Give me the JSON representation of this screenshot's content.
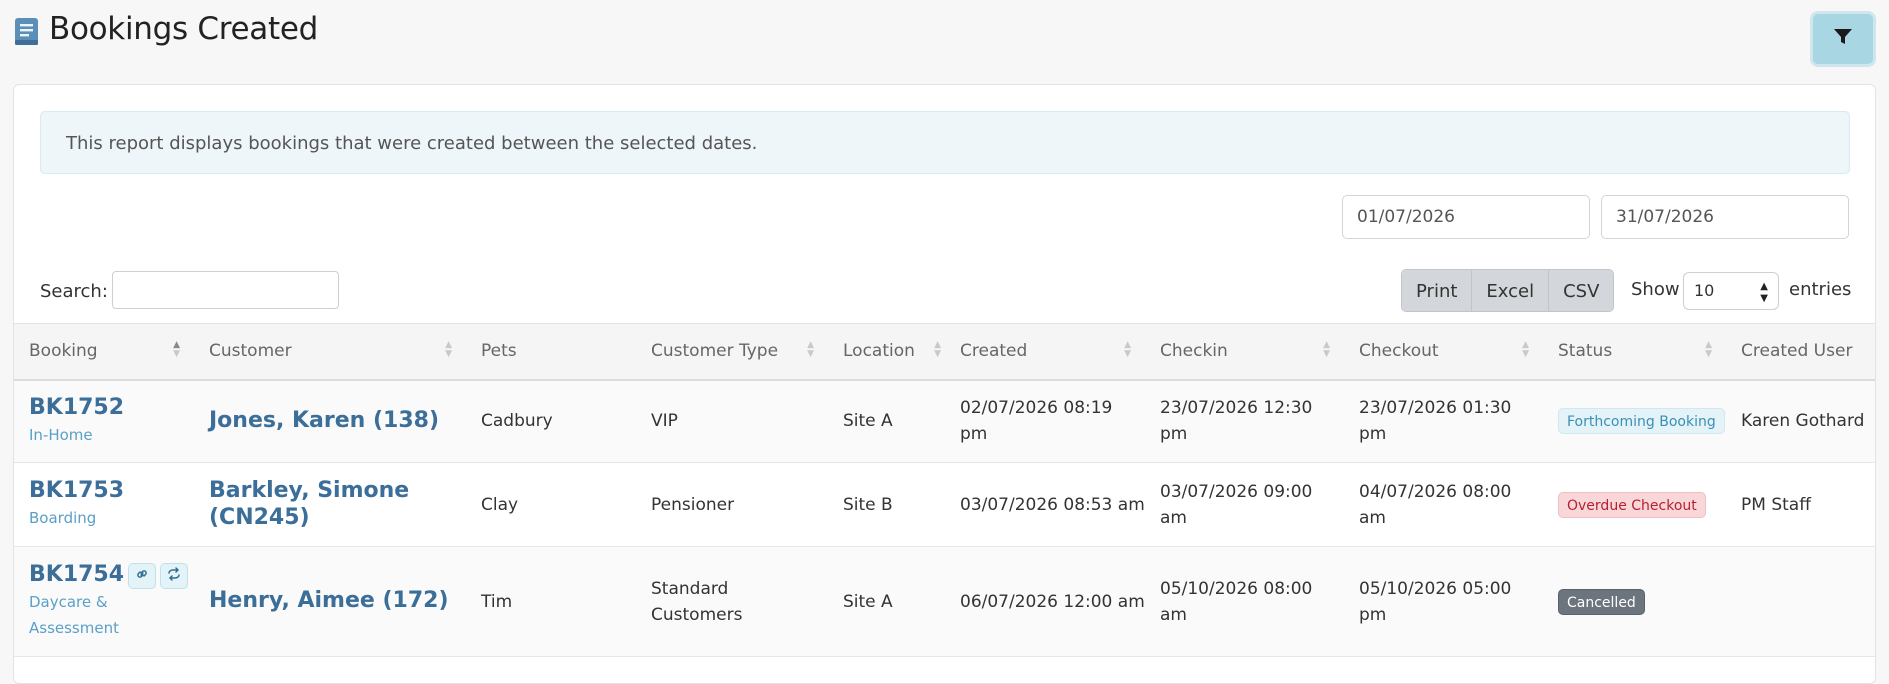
{
  "header": {
    "title": "Bookings Created",
    "title_icon": "report-book-icon",
    "filter_icon": "filter-icon"
  },
  "info": {
    "text": "This report displays bookings that were created between the selected dates."
  },
  "dates": {
    "from": "01/07/2026",
    "to": "31/07/2026"
  },
  "search": {
    "label": "Search:",
    "value": ""
  },
  "export": {
    "print": "Print",
    "excel": "Excel",
    "csv": "CSV"
  },
  "length": {
    "show_label": "Show",
    "value": "10",
    "entries_label": "entries"
  },
  "table": {
    "columns": [
      "Booking",
      "Customer",
      "Pets",
      "Customer Type",
      "Location",
      "Created",
      "Checkin",
      "Checkout",
      "Status",
      "Created User"
    ],
    "rows": [
      {
        "booking": "BK1752",
        "booking_type": "In-Home",
        "customer": "Jones, Karen (138)",
        "pets": "Cadbury",
        "customer_type": "VIP",
        "location": "Site A",
        "created": "02/07/2026 08:19 pm",
        "checkin": "23/07/2026 12:30 pm",
        "checkout": "23/07/2026 01:30 pm",
        "status": "Forthcoming Booking",
        "created_user": "Karen Gothard"
      },
      {
        "booking": "BK1753",
        "booking_type": "Boarding",
        "customer": "Barkley, Simone (CN245)",
        "pets": "Clay",
        "customer_type": "Pensioner",
        "location": "Site B",
        "created": "03/07/2026 08:53 am",
        "checkin": "03/07/2026 09:00 am",
        "checkout": "04/07/2026 08:00 am",
        "status": "Overdue Checkout",
        "created_user": "PM Staff"
      },
      {
        "booking": "BK1754",
        "booking_type": "Daycare & Assessment",
        "customer": "Henry, Aimee (172)",
        "pets": "Tim",
        "customer_type": "Standard Customers",
        "location": "Site A",
        "created": "06/07/2026 12:00 am",
        "checkin": "05/10/2026 08:00 am",
        "checkout": "05/10/2026 05:00 pm",
        "status": "Cancelled",
        "created_user": ""
      }
    ]
  },
  "colors": {
    "link": "#3b6e98",
    "accent": "#a9d6e3",
    "overdue": "#b52130",
    "cancelled": "#6c757d"
  }
}
